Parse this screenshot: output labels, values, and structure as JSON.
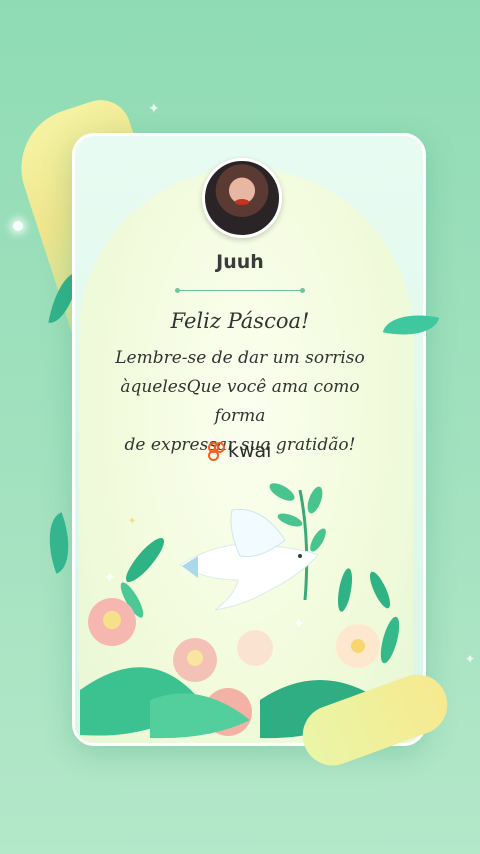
{
  "card": {
    "username": "Juuh",
    "greeting": "Feliz Páscoa!",
    "message_lines": [
      "Lembre-se de dar um sorriso",
      "àquelesQue você ama como forma",
      "de expressar sua gratidão!"
    ],
    "brand": "kwai"
  },
  "colors": {
    "background": "#9fe0bd",
    "accent_green": "#3fc79d",
    "brand_orange": "#ff5a1f"
  },
  "icons": [
    "avatar",
    "kwai-logo-icon",
    "dove-illustration",
    "sparkle-icon"
  ]
}
